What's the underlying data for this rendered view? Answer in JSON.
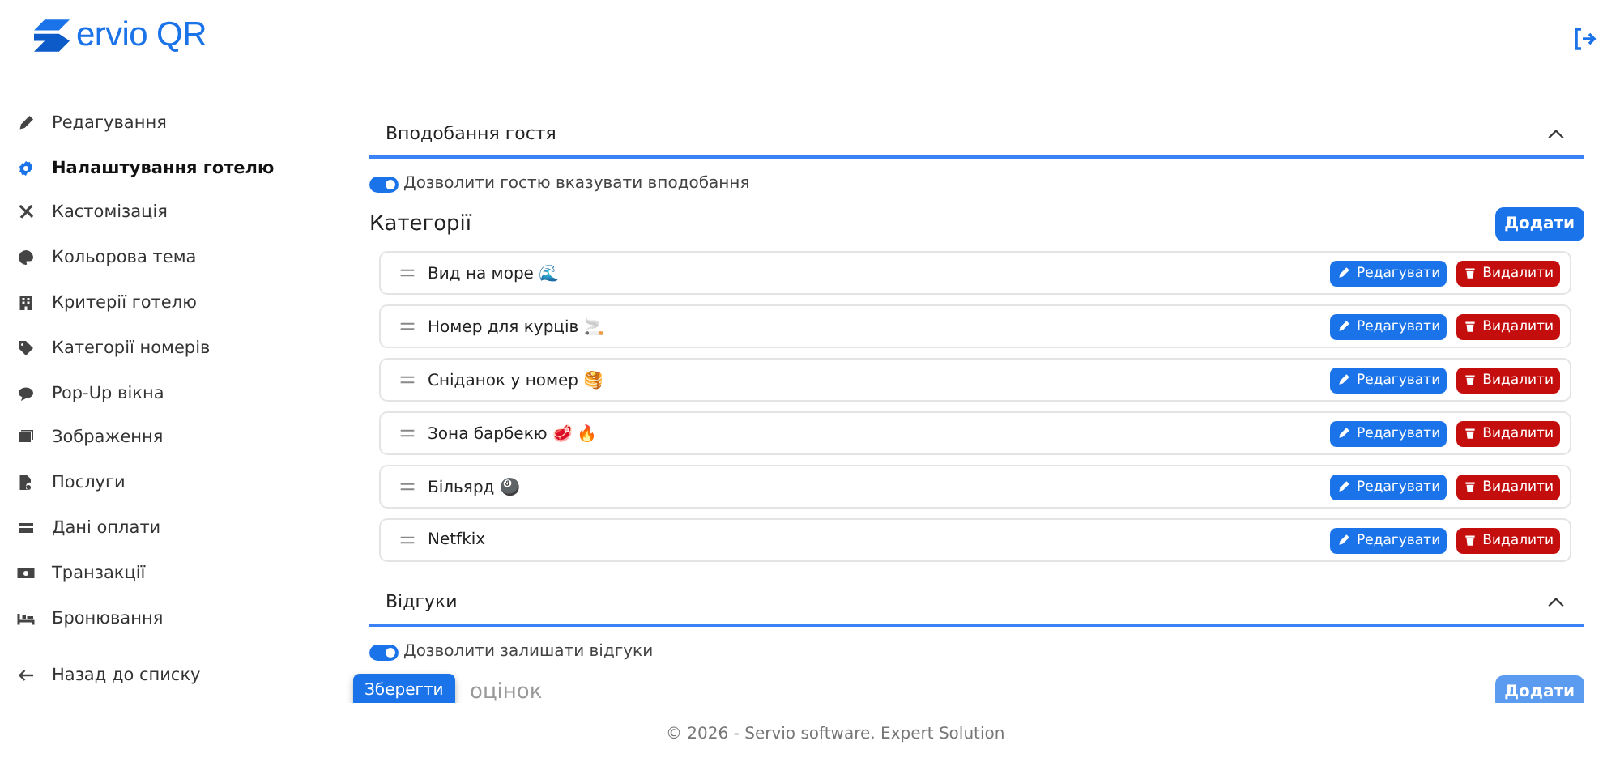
{
  "header": {
    "logo_text": "ervio QR"
  },
  "sidebar": {
    "items": [
      {
        "label": "Редагування",
        "selected": false
      },
      {
        "label": "Налаштування готелю",
        "selected": true
      },
      {
        "label": "Кастомізація",
        "selected": false
      },
      {
        "label": "Кольорова тема",
        "selected": false
      },
      {
        "label": "Критерії готелю",
        "selected": false
      },
      {
        "label": "Категорії номерів",
        "selected": false
      },
      {
        "label": "Pop-Up вікна",
        "selected": false
      },
      {
        "label": "Зображення",
        "selected": false
      },
      {
        "label": "Послуги",
        "selected": false
      },
      {
        "label": "Дані оплати",
        "selected": false
      },
      {
        "label": "Транзакції",
        "selected": false
      },
      {
        "label": "Бронювання",
        "selected": false
      }
    ],
    "back_link": "Назад до списку"
  },
  "sections": [
    {
      "title": "Вподобання гостя",
      "expanded": true,
      "toggle": {
        "label": "Дозволити гостю вказувати вподобання",
        "on": true
      },
      "list_title": "Категорії",
      "add_button": "Додати",
      "items": [
        {
          "name": "Вид на море 🌊",
          "edit_label": "Редагувати",
          "delete_label": "Видалити"
        },
        {
          "name": "Номер для курців 🚬",
          "edit_label": "Редагувати",
          "delete_label": "Видалити"
        },
        {
          "name": "Сніданок у номер 🥞",
          "edit_label": "Редагувати",
          "delete_label": "Видалити"
        },
        {
          "name": "Зона барбекю 🥩 🔥",
          "edit_label": "Редагувати",
          "delete_label": "Видалити"
        },
        {
          "name": "Більярд 🎱",
          "edit_label": "Редагувати",
          "delete_label": "Видалити"
        },
        {
          "name": "Netfkix",
          "edit_label": "Редагувати",
          "delete_label": "Видалити"
        }
      ]
    },
    {
      "title": "Відгуки",
      "expanded": true,
      "toggle": {
        "label": "Дозволити залишати відгуки",
        "on": true
      },
      "list_title": "оцінок",
      "add_button": "Додати"
    }
  ],
  "save_button": "Зберегти",
  "footer": "© 2026 - Servio software. Expert Solution"
}
